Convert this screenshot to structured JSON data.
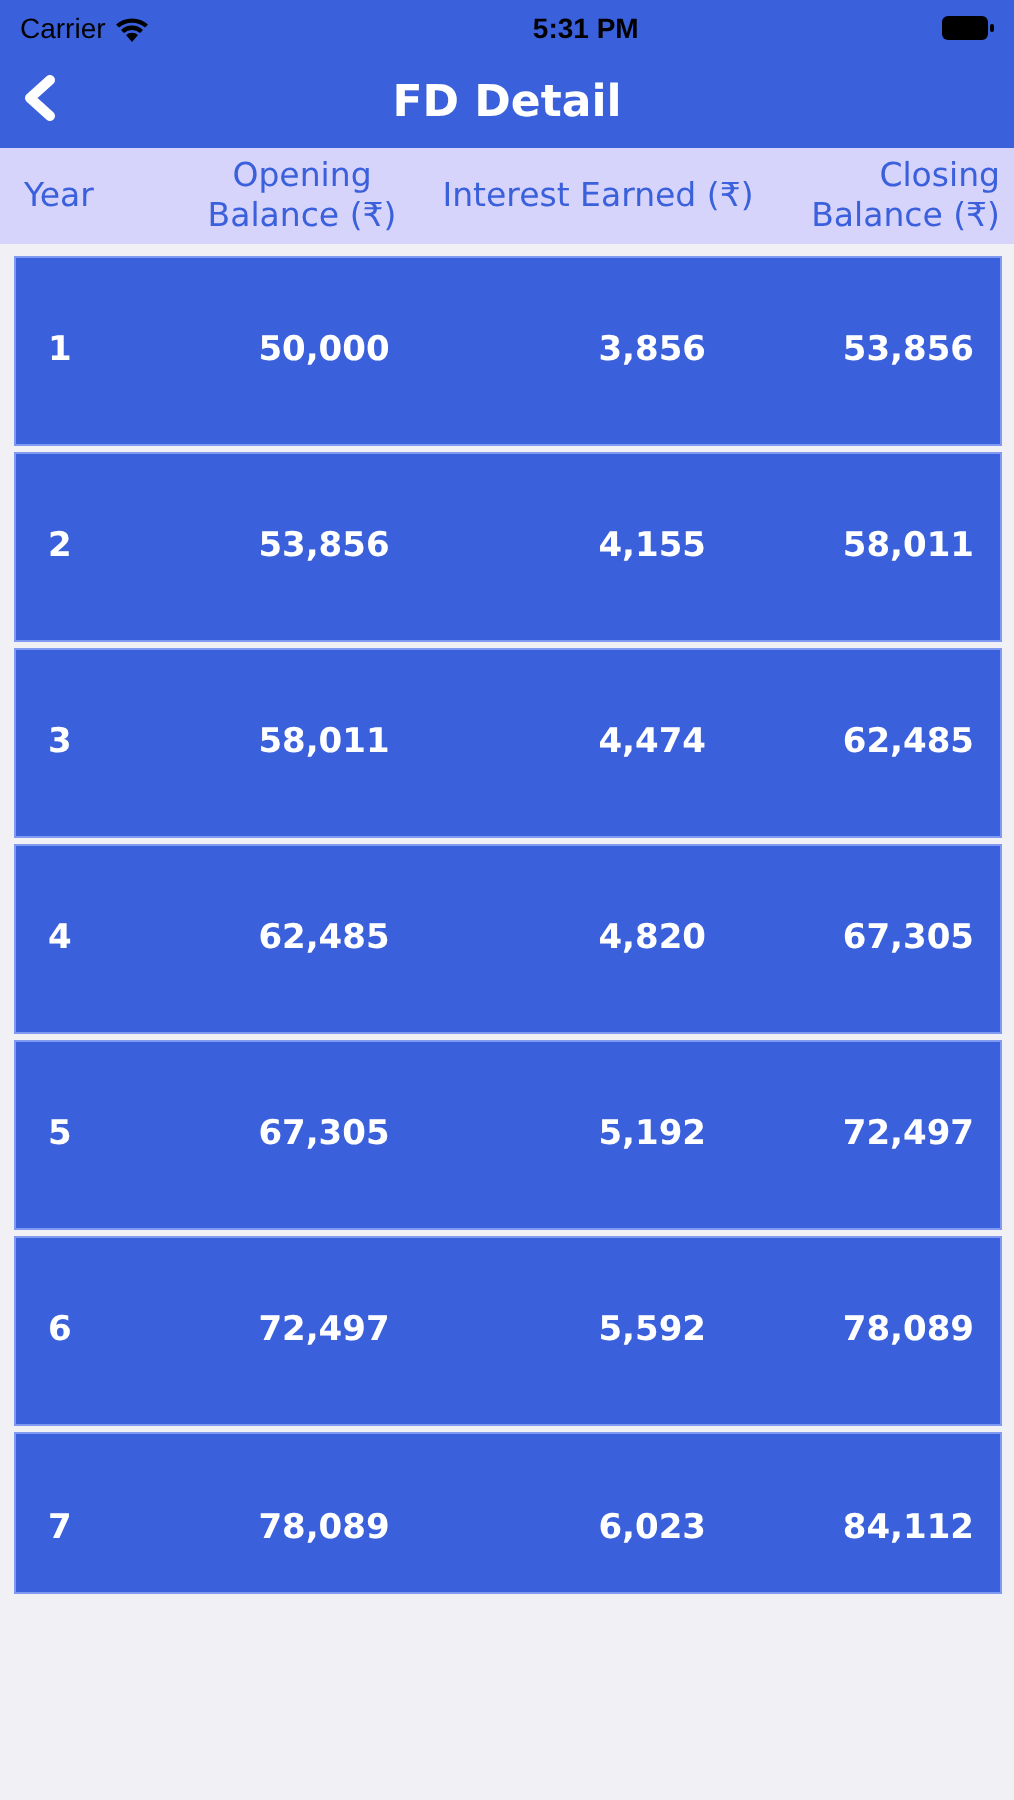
{
  "status_bar": {
    "carrier": "Carrier",
    "time": "5:31 PM"
  },
  "nav": {
    "title": "FD Detail"
  },
  "table": {
    "columns": [
      "Year",
      "Opening Balance (₹)",
      "Interest Earned (₹)",
      "Closing Balance (₹)"
    ],
    "rows": [
      {
        "year": "1",
        "opening": "50,000",
        "interest": "3,856",
        "closing": "53,856"
      },
      {
        "year": "2",
        "opening": "53,856",
        "interest": "4,155",
        "closing": "58,011"
      },
      {
        "year": "3",
        "opening": "58,011",
        "interest": "4,474",
        "closing": "62,485"
      },
      {
        "year": "4",
        "opening": "62,485",
        "interest": "4,820",
        "closing": "67,305"
      },
      {
        "year": "5",
        "opening": "67,305",
        "interest": "5,192",
        "closing": "72,497"
      },
      {
        "year": "6",
        "opening": "72,497",
        "interest": "5,592",
        "closing": "78,089"
      },
      {
        "year": "7",
        "opening": "78,089",
        "interest": "6,023",
        "closing": "84,112"
      }
    ]
  }
}
